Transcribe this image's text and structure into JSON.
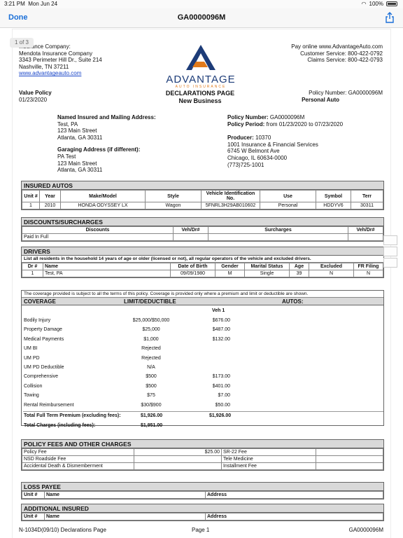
{
  "status": {
    "time": "3:21 PM",
    "date": "Mon Jun 24",
    "battery": "100%"
  },
  "nav": {
    "done": "Done",
    "title": "GA0000096M"
  },
  "page_counter": "1 of 3",
  "insurer": {
    "line1": "Insurance Company:",
    "line2": "Mendota Insurance Company",
    "line3": "3343 Perimeter Hill Dr., Suite 214",
    "line4": "Nashville, TN 37211",
    "link": "www.advantageauto.com"
  },
  "logo": {
    "name": "ADVANTAGE",
    "sub": "AUTO INSURANCE"
  },
  "contact": {
    "line1": "Pay online www.AdvantageAuto.com",
    "line2": "Customer Service: 800-422-0792",
    "line3": "Claims Service: 800-422-0793"
  },
  "header": {
    "value_policy": "Value Policy",
    "date": "01/23/2020",
    "decl": "DECLARATIONS PAGE",
    "new_business": "New Business",
    "policy_number_label": "Policy Number:",
    "policy_number": "GA0000096M",
    "personal_auto": "Personal Auto"
  },
  "insured": {
    "label": "Named Insured and Mailing Address:",
    "name": "Test, PA",
    "addr1": "123 Main Street",
    "addr2": "Atlanta, GA 30311",
    "garage_label": "Garaging Address (if different):",
    "g1": "PA Test",
    "g2": "123 Main Street",
    "g3": "Atlanta, GA 30311"
  },
  "policy": {
    "num_label": "Policy Number:",
    "num": "GA0000096M",
    "period_label": "Policy Period:",
    "period": "from 01/23/2020 to 07/23/2020",
    "producer_label": "Producer:",
    "producer": "10370",
    "p1": "1001 Insurance & Financial Services",
    "p2": "6745 W Belmont Ave",
    "p3": "Chicago, IL 60634-0000",
    "p4": "(773)725-1001"
  },
  "autos": {
    "title": "INSURED AUTOS",
    "headers": [
      "Unit #",
      "Year",
      "Make/Model",
      "Style",
      "Vehicle Identification No.",
      "Use",
      "Symbol",
      "Terr"
    ],
    "row": [
      "1",
      "2010",
      "HONDA ODYSSEY LX",
      "Wagon",
      "5FNRL3H29AB010602",
      "Personal",
      "HDDYV6",
      "30311"
    ]
  },
  "discounts": {
    "title": "DISCOUNTS/SURCHARGES",
    "headers": [
      "Discounts",
      "Veh/Dr#",
      "Surcharges",
      "Veh/Dr#"
    ],
    "row": [
      "Paid In Full",
      "",
      "",
      ""
    ]
  },
  "drivers": {
    "title": "DRIVERS",
    "note": "List all residents in the household 14 years of age or older (licensed or not), all regular operators of the vehicle and excluded drivers.",
    "headers": [
      "Dr #",
      "Name",
      "Date of Birth",
      "Gender",
      "Marital Status",
      "Age",
      "Excluded",
      "FR Filing"
    ],
    "row": [
      "1",
      "Test, PA",
      "09/09/1980",
      "M",
      "Single",
      "39",
      "N",
      "N"
    ]
  },
  "coverage": {
    "note": "The coverage provided is subject to all the terms of this policy.  Coverage is provided only where a premium and limit or deductible are shown.",
    "h1": "COVERAGE",
    "h2": "LIMIT/DEDUCTIBLE",
    "h3": "AUTOS:",
    "veh": "Veh 1",
    "rows": [
      [
        "Bodily Injury",
        "$25,000/$50,000",
        "$676.00"
      ],
      [
        "Property Damage",
        "$25,000",
        "$487.00"
      ],
      [
        "Medical Payments",
        "$1,000",
        "$132.00"
      ],
      [
        "UM BI",
        "Rejected",
        ""
      ],
      [
        "UM PD",
        "Rejected",
        ""
      ],
      [
        "UM PD Deductible",
        "N/A",
        ""
      ],
      [
        "Comprehensive",
        "$500",
        "$173.00"
      ],
      [
        "Collision",
        "$500",
        "$401.00"
      ],
      [
        "Towing",
        "$75",
        "$7.00"
      ],
      [
        "Rental Reimbursement",
        "$30/$900",
        "$50.00"
      ]
    ],
    "term_label": "Total Full Term Premium (excluding fees):",
    "term_amt": "$1,926.00",
    "term_veh": "$1,926.00",
    "charges_label": "Total Charges (including fees):",
    "charges_amt": "$1,951.00"
  },
  "fees": {
    "title": "POLICY FEES AND OTHER CHARGES",
    "r1": [
      "Policy Fee",
      "$25.00",
      "SR-22 Fee",
      ""
    ],
    "r2": [
      "NSD Roadside Fee",
      "",
      "Tele Medicine",
      ""
    ],
    "r3": [
      "Accidental Death & Dismemberment",
      "",
      "Installment Fee",
      ""
    ]
  },
  "loss": {
    "title": "LOSS PAYEE",
    "headers": [
      "Unit #",
      "Name",
      "Address"
    ]
  },
  "addl": {
    "title": "ADDITIONAL INSURED",
    "headers": [
      "Unit #",
      "Name",
      "Address"
    ]
  },
  "footer": {
    "form": "N-1034D(09/10)  Declarations Page",
    "page": "Page 1",
    "policy": "GA0000096M"
  }
}
